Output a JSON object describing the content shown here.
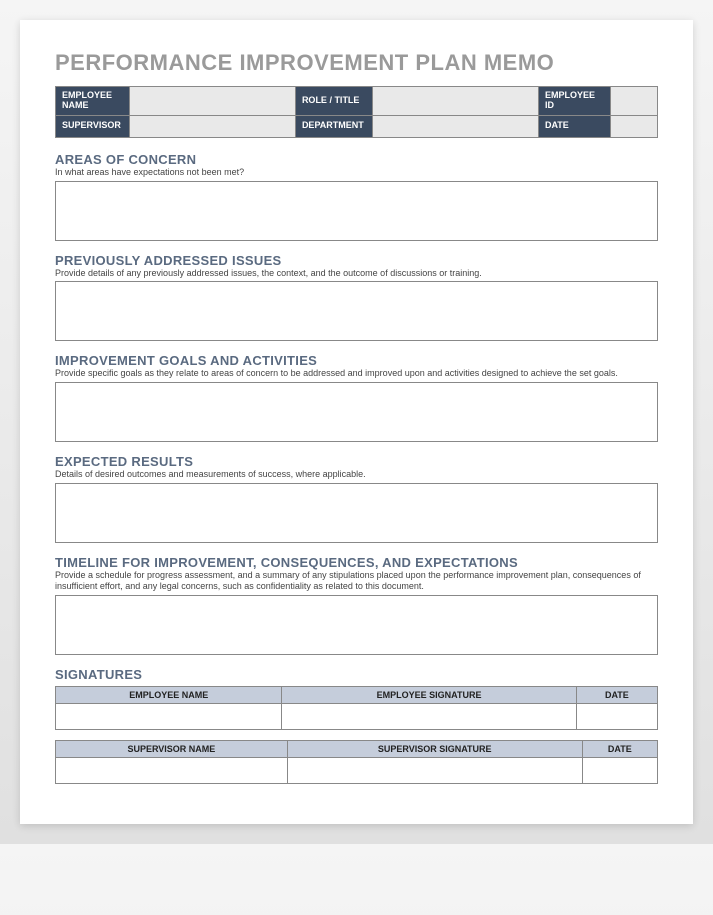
{
  "title": "PERFORMANCE IMPROVEMENT PLAN MEMO",
  "info": {
    "row1": {
      "l1": "EMPLOYEE NAME",
      "l2": "ROLE / TITLE",
      "l3": "EMPLOYEE ID"
    },
    "row2": {
      "l1": "SUPERVISOR",
      "l2": "DEPARTMENT",
      "l3": "DATE"
    }
  },
  "sections": {
    "areas": {
      "title": "AREAS OF CONCERN",
      "desc": "In what areas have expectations not been met?"
    },
    "previous": {
      "title": "PREVIOUSLY ADDRESSED ISSUES",
      "desc": "Provide details of any previously addressed issues, the context, and the outcome of discussions or training."
    },
    "goals": {
      "title": "IMPROVEMENT GOALS AND ACTIVITIES",
      "desc": "Provide specific goals as they relate to areas of concern to be addressed and improved upon and activities designed to achieve the set goals."
    },
    "expected": {
      "title": "EXPECTED RESULTS",
      "desc": "Details of desired outcomes and measurements of success, where applicable."
    },
    "timeline": {
      "title": "TIMELINE FOR IMPROVEMENT, CONSEQUENCES, AND EXPECTATIONS",
      "desc": "Provide a schedule for progress assessment, and a summary of any stipulations placed upon the performance improvement plan, consequences of insufficient effort, and any legal concerns, such as confidentiality as related to this document."
    },
    "signatures": {
      "title": "SIGNATURES"
    }
  },
  "sig1": {
    "h1": "EMPLOYEE NAME",
    "h2": "EMPLOYEE SIGNATURE",
    "h3": "DATE"
  },
  "sig2": {
    "h1": "SUPERVISOR NAME",
    "h2": "SUPERVISOR SIGNATURE",
    "h3": "DATE"
  }
}
